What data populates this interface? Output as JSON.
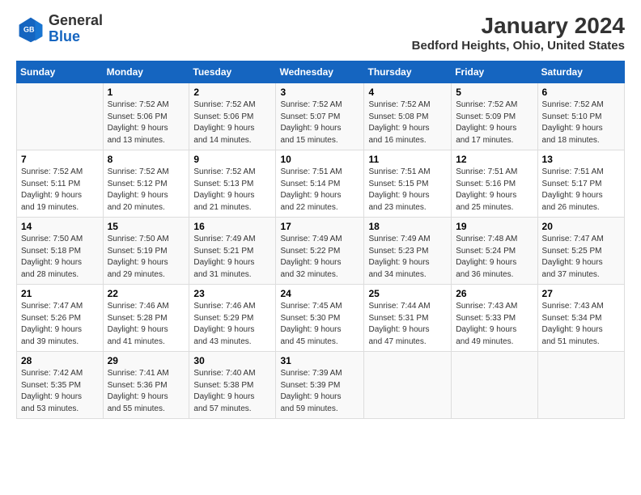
{
  "header": {
    "logo_line1": "General",
    "logo_line2": "Blue",
    "title": "January 2024",
    "subtitle": "Bedford Heights, Ohio, United States"
  },
  "days_of_week": [
    "Sunday",
    "Monday",
    "Tuesday",
    "Wednesday",
    "Thursday",
    "Friday",
    "Saturday"
  ],
  "weeks": [
    [
      {
        "num": "",
        "text": ""
      },
      {
        "num": "1",
        "text": "Sunrise: 7:52 AM\nSunset: 5:06 PM\nDaylight: 9 hours\nand 13 minutes."
      },
      {
        "num": "2",
        "text": "Sunrise: 7:52 AM\nSunset: 5:06 PM\nDaylight: 9 hours\nand 14 minutes."
      },
      {
        "num": "3",
        "text": "Sunrise: 7:52 AM\nSunset: 5:07 PM\nDaylight: 9 hours\nand 15 minutes."
      },
      {
        "num": "4",
        "text": "Sunrise: 7:52 AM\nSunset: 5:08 PM\nDaylight: 9 hours\nand 16 minutes."
      },
      {
        "num": "5",
        "text": "Sunrise: 7:52 AM\nSunset: 5:09 PM\nDaylight: 9 hours\nand 17 minutes."
      },
      {
        "num": "6",
        "text": "Sunrise: 7:52 AM\nSunset: 5:10 PM\nDaylight: 9 hours\nand 18 minutes."
      }
    ],
    [
      {
        "num": "7",
        "text": "Sunrise: 7:52 AM\nSunset: 5:11 PM\nDaylight: 9 hours\nand 19 minutes."
      },
      {
        "num": "8",
        "text": "Sunrise: 7:52 AM\nSunset: 5:12 PM\nDaylight: 9 hours\nand 20 minutes."
      },
      {
        "num": "9",
        "text": "Sunrise: 7:52 AM\nSunset: 5:13 PM\nDaylight: 9 hours\nand 21 minutes."
      },
      {
        "num": "10",
        "text": "Sunrise: 7:51 AM\nSunset: 5:14 PM\nDaylight: 9 hours\nand 22 minutes."
      },
      {
        "num": "11",
        "text": "Sunrise: 7:51 AM\nSunset: 5:15 PM\nDaylight: 9 hours\nand 23 minutes."
      },
      {
        "num": "12",
        "text": "Sunrise: 7:51 AM\nSunset: 5:16 PM\nDaylight: 9 hours\nand 25 minutes."
      },
      {
        "num": "13",
        "text": "Sunrise: 7:51 AM\nSunset: 5:17 PM\nDaylight: 9 hours\nand 26 minutes."
      }
    ],
    [
      {
        "num": "14",
        "text": "Sunrise: 7:50 AM\nSunset: 5:18 PM\nDaylight: 9 hours\nand 28 minutes."
      },
      {
        "num": "15",
        "text": "Sunrise: 7:50 AM\nSunset: 5:19 PM\nDaylight: 9 hours\nand 29 minutes."
      },
      {
        "num": "16",
        "text": "Sunrise: 7:49 AM\nSunset: 5:21 PM\nDaylight: 9 hours\nand 31 minutes."
      },
      {
        "num": "17",
        "text": "Sunrise: 7:49 AM\nSunset: 5:22 PM\nDaylight: 9 hours\nand 32 minutes."
      },
      {
        "num": "18",
        "text": "Sunrise: 7:49 AM\nSunset: 5:23 PM\nDaylight: 9 hours\nand 34 minutes."
      },
      {
        "num": "19",
        "text": "Sunrise: 7:48 AM\nSunset: 5:24 PM\nDaylight: 9 hours\nand 36 minutes."
      },
      {
        "num": "20",
        "text": "Sunrise: 7:47 AM\nSunset: 5:25 PM\nDaylight: 9 hours\nand 37 minutes."
      }
    ],
    [
      {
        "num": "21",
        "text": "Sunrise: 7:47 AM\nSunset: 5:26 PM\nDaylight: 9 hours\nand 39 minutes."
      },
      {
        "num": "22",
        "text": "Sunrise: 7:46 AM\nSunset: 5:28 PM\nDaylight: 9 hours\nand 41 minutes."
      },
      {
        "num": "23",
        "text": "Sunrise: 7:46 AM\nSunset: 5:29 PM\nDaylight: 9 hours\nand 43 minutes."
      },
      {
        "num": "24",
        "text": "Sunrise: 7:45 AM\nSunset: 5:30 PM\nDaylight: 9 hours\nand 45 minutes."
      },
      {
        "num": "25",
        "text": "Sunrise: 7:44 AM\nSunset: 5:31 PM\nDaylight: 9 hours\nand 47 minutes."
      },
      {
        "num": "26",
        "text": "Sunrise: 7:43 AM\nSunset: 5:33 PM\nDaylight: 9 hours\nand 49 minutes."
      },
      {
        "num": "27",
        "text": "Sunrise: 7:43 AM\nSunset: 5:34 PM\nDaylight: 9 hours\nand 51 minutes."
      }
    ],
    [
      {
        "num": "28",
        "text": "Sunrise: 7:42 AM\nSunset: 5:35 PM\nDaylight: 9 hours\nand 53 minutes."
      },
      {
        "num": "29",
        "text": "Sunrise: 7:41 AM\nSunset: 5:36 PM\nDaylight: 9 hours\nand 55 minutes."
      },
      {
        "num": "30",
        "text": "Sunrise: 7:40 AM\nSunset: 5:38 PM\nDaylight: 9 hours\nand 57 minutes."
      },
      {
        "num": "31",
        "text": "Sunrise: 7:39 AM\nSunset: 5:39 PM\nDaylight: 9 hours\nand 59 minutes."
      },
      {
        "num": "",
        "text": ""
      },
      {
        "num": "",
        "text": ""
      },
      {
        "num": "",
        "text": ""
      }
    ]
  ]
}
